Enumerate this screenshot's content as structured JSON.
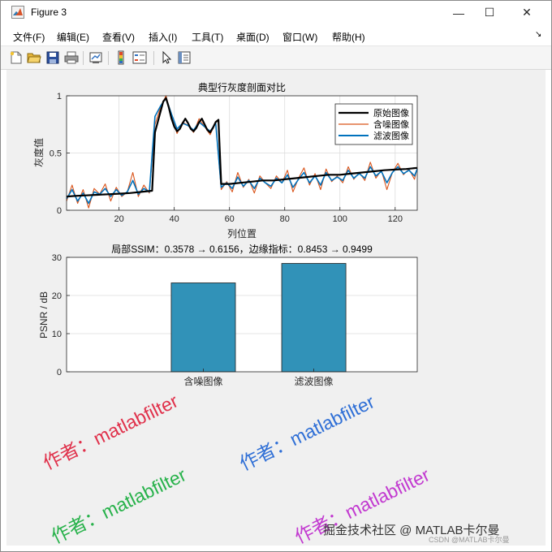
{
  "window": {
    "title": "Figure 3",
    "controls": {
      "minimize": "—",
      "maximize": "☐",
      "close": "✕"
    }
  },
  "menu": [
    "文件(F)",
    "编辑(E)",
    "查看(V)",
    "插入(I)",
    "工具(T)",
    "桌面(D)",
    "窗口(W)",
    "帮助(H)"
  ],
  "menu_arrow": "↘",
  "toolbar": [
    "new-figure-icon",
    "open-file-icon",
    "save-icon",
    "print-icon",
    "link-plot-icon",
    "insert-colorbar-icon",
    "insert-legend-icon",
    "pointer-icon",
    "property-inspector-icon"
  ],
  "colors": {
    "figure_bg": "#f0f0f0",
    "original": "#000000",
    "noisy": "#d95319",
    "filtered": "#0072bd",
    "bar": "#3192b8"
  },
  "chart_data": [
    {
      "type": "line",
      "title": "典型行灰度剖面对比",
      "xlabel": "列位置",
      "ylabel": "灰度值",
      "xlim": [
        1,
        128
      ],
      "ylim": [
        0,
        1
      ],
      "xticks": [
        20,
        40,
        60,
        80,
        100,
        120
      ],
      "yticks": [
        0,
        0.5,
        1
      ],
      "grid": true,
      "legend_position": "top-right",
      "legend": [
        "原始图像",
        "含噪图像",
        "滤波图像"
      ],
      "series": [
        {
          "name": "原始图像",
          "x": [
            1,
            4,
            8,
            12,
            16,
            20,
            24,
            28,
            32,
            33,
            34,
            35,
            36,
            37,
            38,
            39,
            40,
            41,
            42,
            43,
            44,
            45,
            46,
            47,
            48,
            49,
            50,
            51,
            52,
            53,
            54,
            55,
            56,
            57,
            60,
            64,
            68,
            72,
            76,
            80,
            84,
            88,
            92,
            96,
            100,
            104,
            108,
            112,
            116,
            120,
            124,
            128
          ],
          "y": [
            0.12,
            0.125,
            0.13,
            0.135,
            0.14,
            0.145,
            0.15,
            0.16,
            0.17,
            0.68,
            0.77,
            0.86,
            0.95,
            0.98,
            0.9,
            0.8,
            0.73,
            0.69,
            0.71,
            0.76,
            0.8,
            0.76,
            0.71,
            0.69,
            0.72,
            0.77,
            0.8,
            0.75,
            0.7,
            0.68,
            0.72,
            0.77,
            0.79,
            0.23,
            0.23,
            0.24,
            0.25,
            0.26,
            0.26,
            0.27,
            0.28,
            0.29,
            0.3,
            0.31,
            0.31,
            0.32,
            0.33,
            0.34,
            0.35,
            0.355,
            0.36,
            0.37
          ]
        },
        {
          "name": "含噪图像",
          "x": [
            1,
            3,
            5,
            7,
            9,
            11,
            13,
            15,
            17,
            19,
            21,
            23,
            25,
            27,
            29,
            31,
            33,
            35,
            37,
            39,
            41,
            43,
            45,
            47,
            49,
            51,
            53,
            55,
            57,
            59,
            61,
            63,
            65,
            67,
            69,
            71,
            73,
            75,
            77,
            79,
            81,
            83,
            85,
            87,
            89,
            91,
            93,
            95,
            97,
            99,
            101,
            103,
            105,
            107,
            109,
            111,
            113,
            115,
            117,
            119,
            121,
            123,
            125,
            127,
            128
          ],
          "y": [
            0.08,
            0.22,
            0.06,
            0.18,
            0.02,
            0.19,
            0.14,
            0.23,
            0.08,
            0.2,
            0.12,
            0.16,
            0.33,
            0.12,
            0.22,
            0.15,
            0.75,
            0.9,
            1.0,
            0.82,
            0.67,
            0.77,
            0.74,
            0.68,
            0.8,
            0.73,
            0.66,
            0.77,
            0.18,
            0.25,
            0.16,
            0.33,
            0.2,
            0.27,
            0.15,
            0.3,
            0.24,
            0.19,
            0.3,
            0.24,
            0.35,
            0.16,
            0.28,
            0.37,
            0.22,
            0.32,
            0.18,
            0.36,
            0.25,
            0.3,
            0.24,
            0.38,
            0.27,
            0.33,
            0.26,
            0.42,
            0.28,
            0.35,
            0.18,
            0.33,
            0.41,
            0.31,
            0.36,
            0.27,
            0.37
          ]
        },
        {
          "name": "滤波图像",
          "x": [
            1,
            3,
            5,
            7,
            9,
            11,
            13,
            15,
            17,
            19,
            21,
            23,
            25,
            27,
            29,
            31,
            33,
            35,
            37,
            39,
            41,
            43,
            45,
            47,
            49,
            51,
            53,
            55,
            57,
            59,
            61,
            63,
            65,
            67,
            69,
            71,
            73,
            75,
            77,
            79,
            81,
            83,
            85,
            87,
            89,
            91,
            93,
            95,
            97,
            99,
            101,
            103,
            105,
            107,
            109,
            111,
            113,
            115,
            117,
            119,
            121,
            123,
            125,
            127,
            128
          ],
          "y": [
            0.1,
            0.18,
            0.08,
            0.15,
            0.06,
            0.16,
            0.14,
            0.19,
            0.12,
            0.18,
            0.13,
            0.16,
            0.26,
            0.14,
            0.19,
            0.16,
            0.82,
            0.91,
            0.98,
            0.84,
            0.71,
            0.76,
            0.74,
            0.7,
            0.77,
            0.73,
            0.69,
            0.76,
            0.2,
            0.24,
            0.19,
            0.29,
            0.21,
            0.26,
            0.19,
            0.28,
            0.24,
            0.21,
            0.28,
            0.24,
            0.31,
            0.2,
            0.27,
            0.33,
            0.24,
            0.3,
            0.22,
            0.33,
            0.26,
            0.29,
            0.26,
            0.35,
            0.28,
            0.32,
            0.28,
            0.38,
            0.3,
            0.34,
            0.24,
            0.33,
            0.38,
            0.32,
            0.35,
            0.3,
            0.36
          ]
        }
      ]
    },
    {
      "type": "bar",
      "title": "局部SSIM：0.3578 → 0.6156，边缘指标：0.8453 → 0.9499",
      "ylabel": "PSNR / dB",
      "xlabel": "",
      "categories": [
        "含噪图像",
        "滤波图像"
      ],
      "values": [
        23.3,
        28.4
      ],
      "ylim": [
        0,
        30
      ],
      "yticks": [
        0,
        10,
        20,
        30
      ],
      "grid": true
    }
  ],
  "watermarks": [
    {
      "text": "作者：matlabfilter",
      "color": "#e0314b"
    },
    {
      "text": "作者：matlabfilter",
      "color": "#2f6fd6"
    },
    {
      "text": "作者：matlabfilter",
      "color": "#28b24b"
    },
    {
      "text": "作者：matlabfilter",
      "color": "#c23ad0"
    }
  ],
  "overlay_text": "掘金技术社区 @ MATLAB卡尔曼",
  "overlay_text_small": "CSDN @MATLAB卡尔曼"
}
